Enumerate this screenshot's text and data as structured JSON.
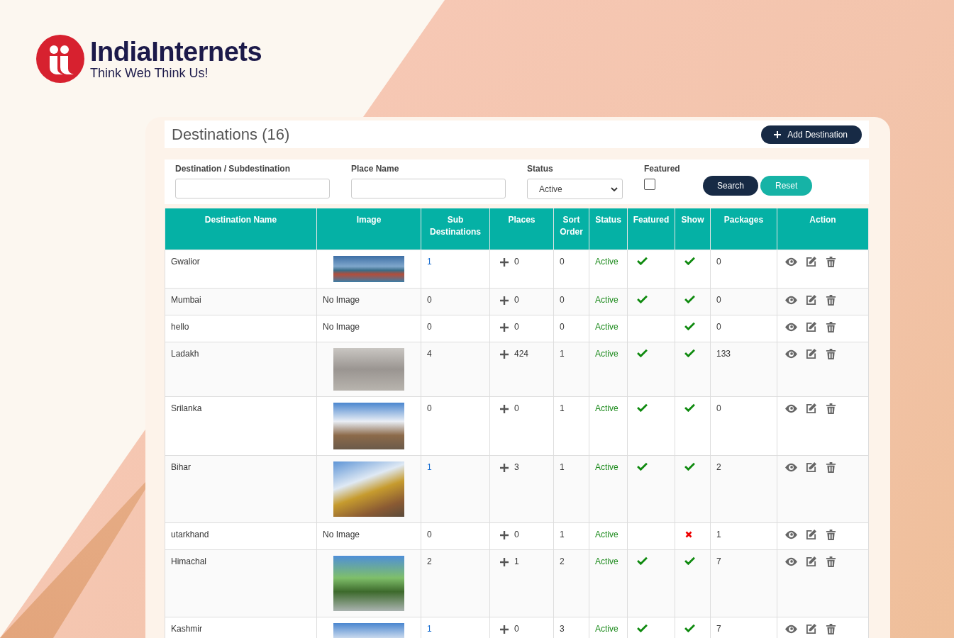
{
  "brand": {
    "name": "IndiaInternets",
    "tagline": "Think Web Think Us!"
  },
  "header": {
    "title": "Destinations (16)",
    "add_button": "Add Destination"
  },
  "filters": {
    "destination_label": "Destination / Subdestination",
    "place_label": "Place Name",
    "status_label": "Status",
    "status_value": "Active",
    "featured_label": "Featured",
    "featured_checked": false,
    "search_button": "Search",
    "reset_button": "Reset"
  },
  "table": {
    "columns": [
      "Destination Name",
      "Image",
      "Sub Destinations",
      "Places",
      "Sort Order",
      "Status",
      "Featured",
      "Show",
      "Packages",
      "Action"
    ],
    "rows": [
      {
        "name": "Gwalior",
        "image": {
          "kind": "panorama"
        },
        "sub": {
          "text": "1",
          "link": true
        },
        "places": "0",
        "sort": "0",
        "status": "Active",
        "featured": true,
        "show": true,
        "packages": "0"
      },
      {
        "name": "Mumbai",
        "image": {
          "kind": "none",
          "text": "No Image"
        },
        "sub": {
          "text": "0",
          "link": false
        },
        "places": "0",
        "sort": "0",
        "status": "Active",
        "featured": true,
        "show": true,
        "packages": "0"
      },
      {
        "name": "hello",
        "image": {
          "kind": "none",
          "text": "No Image"
        },
        "sub": {
          "text": "0",
          "link": false
        },
        "places": "0",
        "sort": "0",
        "status": "Active",
        "featured": false,
        "show": true,
        "packages": "0"
      },
      {
        "name": "Ladakh",
        "image": {
          "kind": "photo"
        },
        "sub": {
          "text": "4",
          "link": false
        },
        "places": "424",
        "sort": "1",
        "status": "Active",
        "featured": true,
        "show": true,
        "packages": "133"
      },
      {
        "name": "Srilanka",
        "image": {
          "kind": "photo"
        },
        "sub": {
          "text": "0",
          "link": false
        },
        "places": "0",
        "sort": "1",
        "status": "Active",
        "featured": true,
        "show": true,
        "packages": "0"
      },
      {
        "name": "Bihar",
        "image": {
          "kind": "photo"
        },
        "sub": {
          "text": "1",
          "link": true
        },
        "places": "3",
        "sort": "1",
        "status": "Active",
        "featured": true,
        "show": true,
        "packages": "2"
      },
      {
        "name": "utarkhand",
        "image": {
          "kind": "none",
          "text": "No Image"
        },
        "sub": {
          "text": "0",
          "link": false
        },
        "places": "0",
        "sort": "1",
        "status": "Active",
        "featured": false,
        "show": false,
        "packages": "1"
      },
      {
        "name": "Himachal",
        "image": {
          "kind": "photo"
        },
        "sub": {
          "text": "2",
          "link": false
        },
        "places": "1",
        "sort": "2",
        "status": "Active",
        "featured": true,
        "show": true,
        "packages": "7"
      },
      {
        "name": "Kashmir",
        "image": {
          "kind": "photo"
        },
        "sub": {
          "text": "1",
          "link": true
        },
        "places": "0",
        "sort": "3",
        "status": "Active",
        "featured": true,
        "show": true,
        "packages": "7"
      }
    ]
  }
}
